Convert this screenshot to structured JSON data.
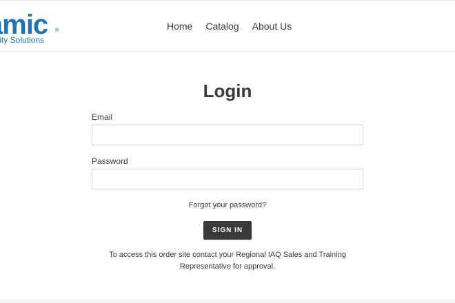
{
  "logo": {
    "brand": "amic",
    "registered": "®",
    "tagline": "ality Solutions",
    "color": "#1f73b7"
  },
  "nav": {
    "items": [
      {
        "label": "Home"
      },
      {
        "label": "Catalog"
      },
      {
        "label": "About Us"
      }
    ]
  },
  "login": {
    "title": "Login",
    "email_label": "Email",
    "email_value": "",
    "password_label": "Password",
    "password_value": "",
    "forgot_link": "Forgot your password?",
    "submit_label": "SIGN IN",
    "note": "To access this order site contact your Regional IAQ Sales and Training Representative for approval."
  },
  "colors": {
    "text": "#3a3a3a",
    "button_bg": "#3a3a3a",
    "button_text": "#ffffff",
    "input_border": "#d4d4d4"
  }
}
